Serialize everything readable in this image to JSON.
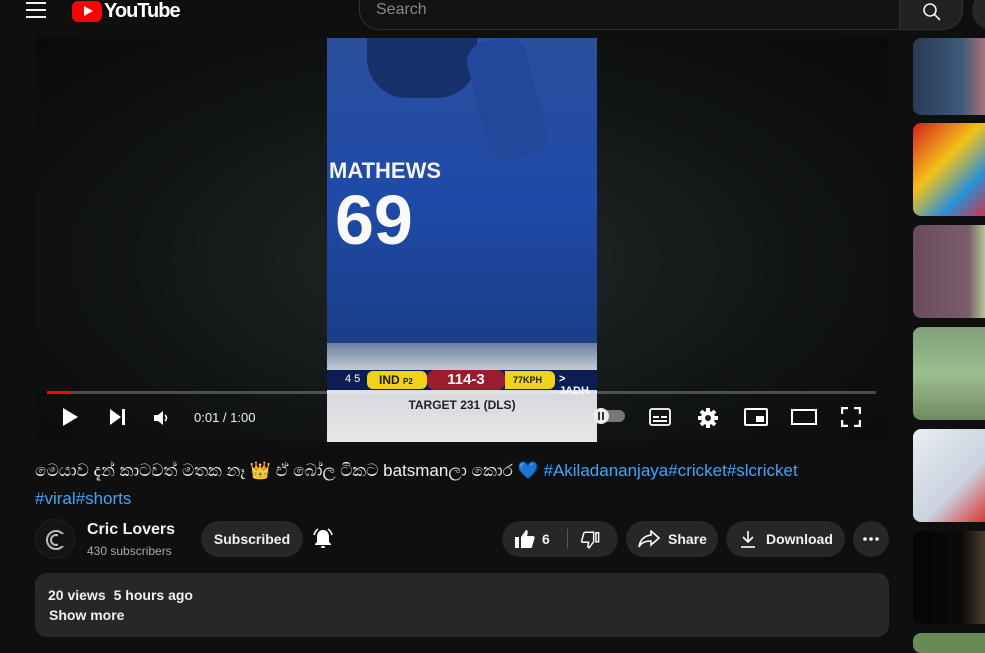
{
  "header": {
    "logo_text": "YouTube",
    "search_placeholder": "Search"
  },
  "player": {
    "time_current": "0:01",
    "time_total": "1:00",
    "progress": 0.03,
    "frame": {
      "player_name": "MATHEWS",
      "jersey_number": "69",
      "score_overs": "4 5",
      "team": "IND",
      "team_sub": "P2",
      "score": "114-3",
      "speed": "77KPH",
      "next": "> JADH",
      "target": "TARGET 231 (DLS)"
    }
  },
  "video": {
    "title_text": "මෙයාව දැන් කාටවත් මතක නෑ 👑 ඒ බෝල ටිකට batsmanලා කොර 💙",
    "hashtags_line1": "#Akiladananjaya#cricket#slcricket",
    "hashtags_line2": "#viral#shorts"
  },
  "channel": {
    "name": "Cric Lovers",
    "subscribers": "430 subscribers",
    "subscribe_label": "Subscribed"
  },
  "actions": {
    "like_count": "6",
    "share_label": "Share",
    "download_label": "Download"
  },
  "description": {
    "views": "20 views",
    "age": "5 hours ago",
    "show_more": "Show more"
  },
  "colors": {
    "accent": "#ff0000",
    "link": "#3ea6ff",
    "background": "#0f0f0f",
    "pill": "#272727"
  }
}
